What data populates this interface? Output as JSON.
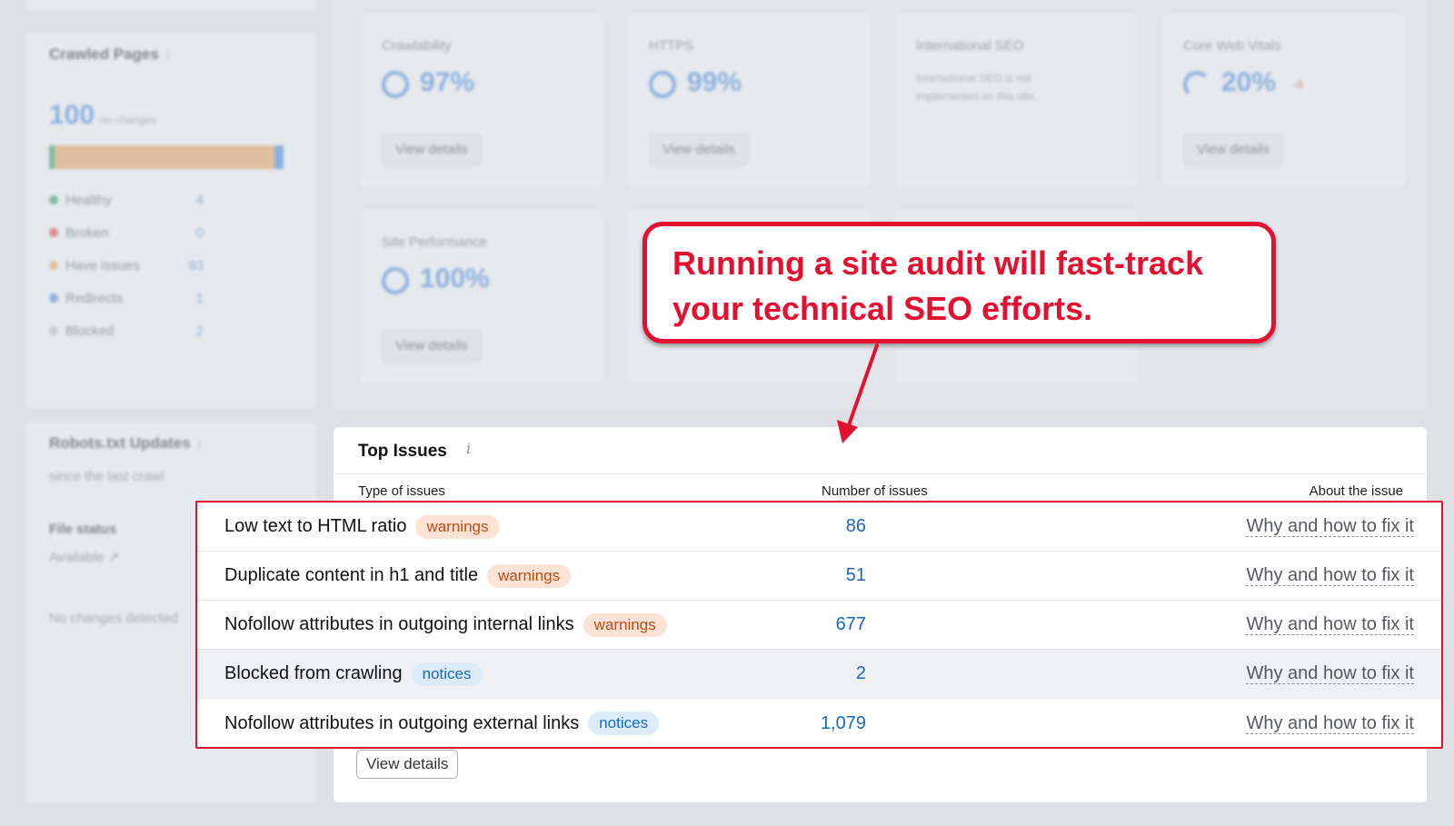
{
  "background": {
    "top_cards": [
      {
        "title": "Crawlability",
        "percent": "97%",
        "button": "View details"
      },
      {
        "title": "HTTPS",
        "percent": "99%",
        "button": "View details"
      },
      {
        "title": "International SEO",
        "description": "International SEO is not implemented on this site."
      },
      {
        "title": "Core Web Vitals",
        "percent": "20%",
        "delta": "-8",
        "button": "View details"
      },
      {
        "title": "Site Performance",
        "percent": "100%",
        "button": "View details"
      }
    ],
    "crawled_pages": {
      "title": "Crawled Pages",
      "info": "i",
      "count": "100",
      "count_note": "no changes",
      "legend": [
        {
          "label": "Healthy",
          "value": "4",
          "color": "#39a06b"
        },
        {
          "label": "Broken",
          "value": "0",
          "color": "#e0484e"
        },
        {
          "label": "Have issues",
          "value": "93",
          "color": "#e3a46a"
        },
        {
          "label": "Redirects",
          "value": "1",
          "color": "#4b8bd9"
        },
        {
          "label": "Blocked",
          "value": "2",
          "color": "#b7bcc2"
        }
      ]
    },
    "robots": {
      "title": "Robots.txt Updates",
      "info": "i",
      "subtitle": "since the last crawl",
      "file_status_label": "File status",
      "file_status_value": "Available",
      "no_changes": "No changes detected"
    }
  },
  "top_issues": {
    "title": "Top Issues",
    "info": "i",
    "headers": {
      "type": "Type of issues",
      "number": "Number of issues",
      "about": "About the issue"
    },
    "rows": [
      {
        "name": "Low text to HTML ratio",
        "badge": "warnings",
        "badge_type": "warn",
        "count": "86",
        "link": "Why and how to fix it"
      },
      {
        "name": "Duplicate content in h1 and title",
        "badge": "warnings",
        "badge_type": "warn",
        "count": "51",
        "link": "Why and how to fix it"
      },
      {
        "name": "Nofollow attributes in outgoing internal links",
        "badge": "warnings",
        "badge_type": "warn",
        "count": "677",
        "link": "Why and how to fix it"
      },
      {
        "name": "Blocked from crawling",
        "badge": "notices",
        "badge_type": "note",
        "count": "2",
        "link": "Why and how to fix it"
      },
      {
        "name": "Nofollow attributes in outgoing external links",
        "badge": "notices",
        "badge_type": "note",
        "count": "1,079",
        "link": "Why and how to fix it"
      }
    ],
    "view_details": "View details"
  },
  "callout": {
    "line1": "Running a site audit will fast-track",
    "line2": "your technical SEO efforts."
  },
  "colors": {
    "accent_red": "#e3102f",
    "link_blue": "#1668c6",
    "warn_text": "#c04a10",
    "notice_text": "#1467c6"
  }
}
